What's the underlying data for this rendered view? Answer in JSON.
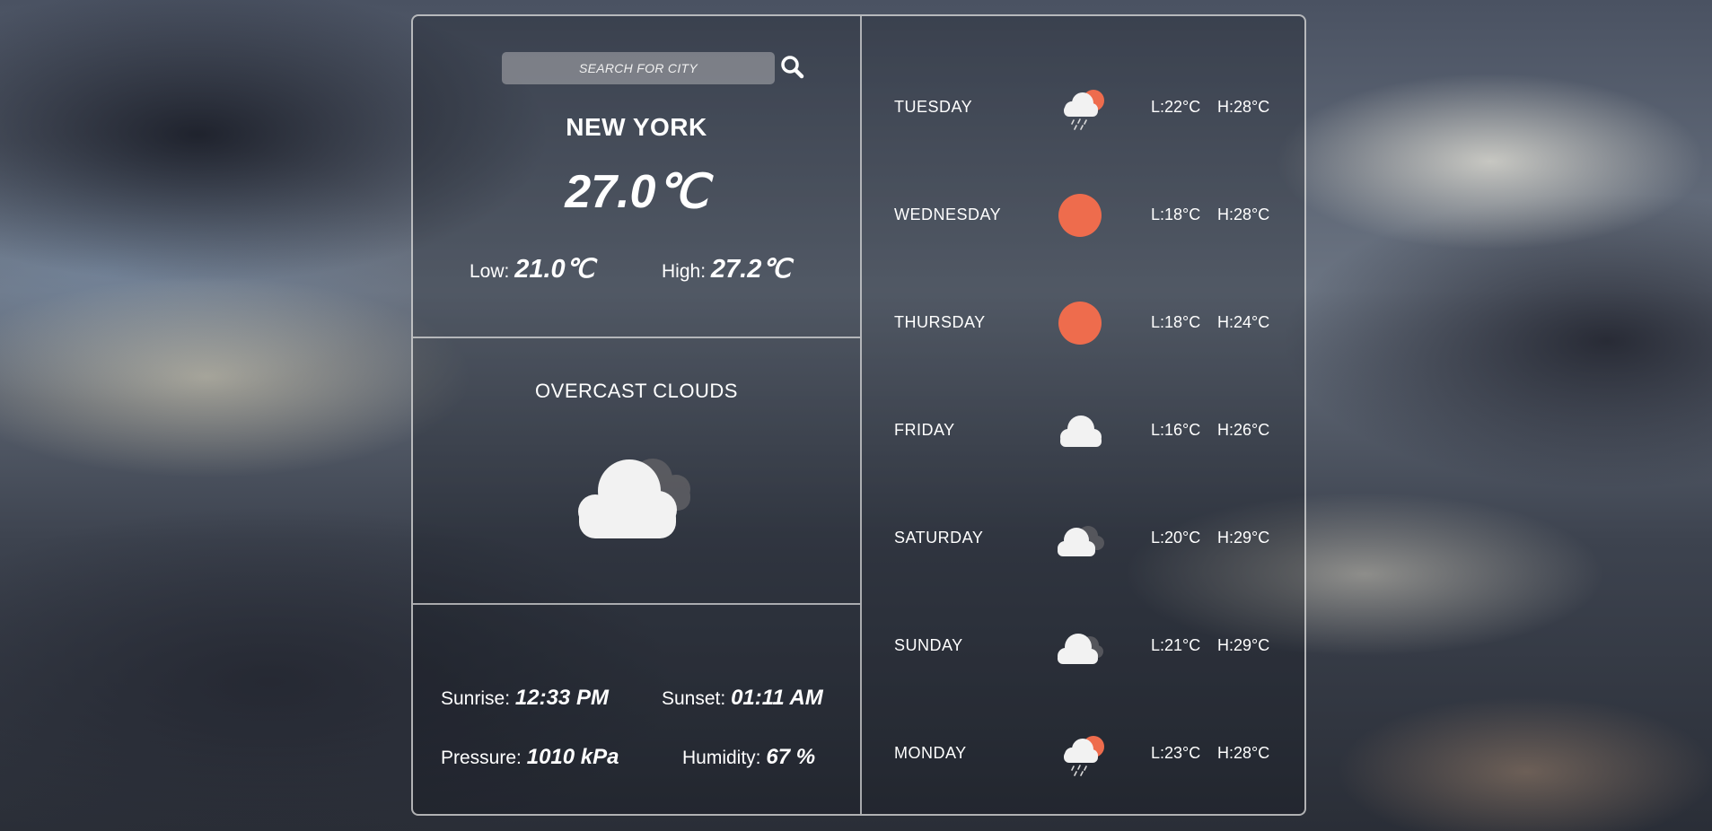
{
  "search": {
    "placeholder": "SEARCH FOR CITY"
  },
  "current": {
    "city": "NEW YORK",
    "temperature": "27.0℃",
    "low_label": "Low:",
    "low_value": "21.0℃",
    "high_label": "High:",
    "high_value": "27.2℃",
    "condition": "OVERCAST CLOUDS",
    "condition_icon": "overcast-clouds-icon"
  },
  "details": {
    "sunrise_label": "Sunrise:",
    "sunrise_value": "12:33 PM",
    "sunset_label": "Sunset:",
    "sunset_value": "01:11 AM",
    "pressure_label": "Pressure:",
    "pressure_value": "1010 kPa",
    "humidity_label": "Humidity:",
    "humidity_value": "67 %"
  },
  "forecast": [
    {
      "day": "TUESDAY",
      "icon": "rain-sun-icon",
      "low": "L:22°C",
      "high": "H:28°C"
    },
    {
      "day": "WEDNESDAY",
      "icon": "sun-icon",
      "low": "L:18°C",
      "high": "H:28°C"
    },
    {
      "day": "THURSDAY",
      "icon": "sun-icon",
      "low": "L:18°C",
      "high": "H:24°C"
    },
    {
      "day": "FRIDAY",
      "icon": "cloud-icon",
      "low": "L:16°C",
      "high": "H:26°C"
    },
    {
      "day": "SATURDAY",
      "icon": "broken-clouds-icon",
      "low": "L:20°C",
      "high": "H:29°C"
    },
    {
      "day": "SUNDAY",
      "icon": "broken-clouds-icon",
      "low": "L:21°C",
      "high": "H:29°C"
    },
    {
      "day": "MONDAY",
      "icon": "rain-sun-icon",
      "low": "L:23°C",
      "high": "H:28°C"
    }
  ],
  "colors": {
    "sun": "#EE6C4D",
    "cloud": "#F2F2F2",
    "cloud_dark": "#6E6E72",
    "border": "#E1E1E1"
  }
}
